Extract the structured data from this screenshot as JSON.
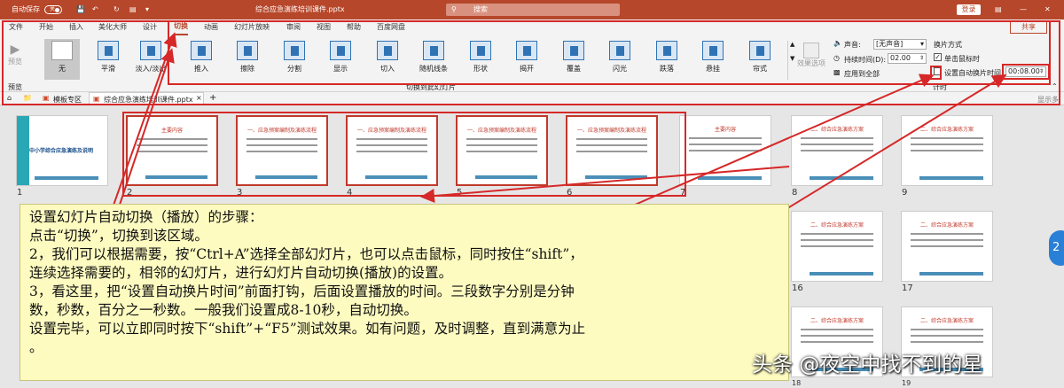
{
  "titlebar": {
    "autosave_label": "自动保存",
    "toggle_state": "关",
    "file_name": "综合应急演练培训课件.pptx",
    "search_placeholder": "搜索",
    "login_label": "登录",
    "bg_color": "#b7472a"
  },
  "tabs": [
    {
      "label": "文件"
    },
    {
      "label": "开始"
    },
    {
      "label": "插入"
    },
    {
      "label": "美化大师"
    },
    {
      "label": "设计"
    },
    {
      "label": "切换",
      "active": true
    },
    {
      "label": "动画"
    },
    {
      "label": "幻灯片放映"
    },
    {
      "label": "审阅"
    },
    {
      "label": "视图"
    },
    {
      "label": "帮助"
    },
    {
      "label": "百度网盘"
    }
  ],
  "share_label": "共享",
  "ribbon": {
    "preview_label": "预览",
    "preview_group_label": "预览",
    "transitions": [
      "无",
      "平滑",
      "淡入/淡出",
      "推入",
      "擦除",
      "分割",
      "显示",
      "切入",
      "随机线条",
      "形状",
      "揭开",
      "覆盖",
      "闪光",
      "跌落",
      "悬挂",
      "帘式"
    ],
    "effect_options_label": "效果选项",
    "group_label": "切换到此幻灯片",
    "sound_label": "声音:",
    "sound_value": "[无声音]",
    "duration_label": "持续时间(D):",
    "duration_value": "02.00",
    "apply_all_label": "应用到全部",
    "advance_label": "换片方式",
    "on_click_label": "单击鼠标时",
    "auto_after_label": "设置自动换片时间:",
    "auto_after_value": "00:08.00",
    "timing_group_label": "计时"
  },
  "docbar": {
    "template_tab": "模板专区",
    "doc_tab": "综合应急演练培训课件.pptx",
    "show_more": "显示多"
  },
  "slides": [
    {
      "num": "1",
      "title": "中小学综合应急演练及说明"
    },
    {
      "num": "2",
      "title": "主要内容"
    },
    {
      "num": "3",
      "title": "一、应急预案编制及演练流程"
    },
    {
      "num": "4",
      "title": "一、应急预案编制及演练流程"
    },
    {
      "num": "5",
      "title": "一、应急预案编制及演练流程"
    },
    {
      "num": "6",
      "title": "一、应急预案编制及演练流程"
    },
    {
      "num": "7",
      "title": "主要内容"
    },
    {
      "num": "8",
      "title": "二、综合应急演练方案"
    },
    {
      "num": "9",
      "title": "二、综合应急演练方案"
    },
    {
      "num": "16",
      "title": "二、综合应急演练方案"
    },
    {
      "num": "17",
      "title": "二、综合应急演练方案"
    },
    {
      "num": "18",
      "title": "二、综合应急演练方案"
    },
    {
      "num": "19",
      "title": "二、综合应急演练方案"
    }
  ],
  "note": {
    "lines": [
      "设置幻灯片自动切换（播放）的步骤：",
      "点击“切换”，切换到该区域。",
      "2，我们可以根据需要，按“Ctrl+A”选择全部幻灯片，也可以点击鼠标，同时按住“shift”，",
      "连续选择需要的，相邻的幻灯片，进行幻灯片自动切换(播放)的设置。",
      "3，看这里，把“设置自动换片时间”前面打钩，后面设置播放的时间。三段数字分别是分钟",
      "数，秒数，百分之一秒数。一般我们设置成8-10秒，自动切换。",
      "设置完毕，可以立即同时按下“shift”+“F5”测试效果。如有问题，及时调整，直到满意为止",
      "。"
    ]
  },
  "watermark": "头条 @夜空中找不到的星",
  "side_badge": "2"
}
